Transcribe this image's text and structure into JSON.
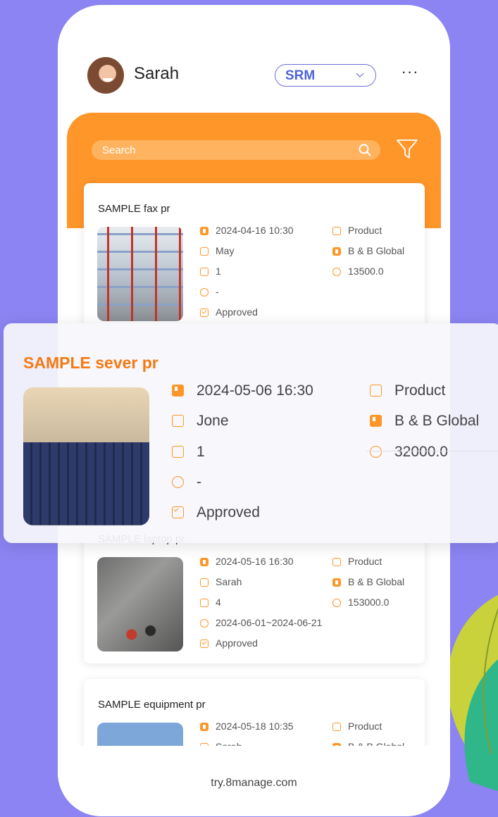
{
  "user": {
    "name": "Sarah"
  },
  "module": {
    "label": "SRM"
  },
  "menu": {
    "more": "···"
  },
  "search": {
    "placeholder": "Search"
  },
  "cards": [
    {
      "title": "SAMPLE fax pr",
      "datetime": "2024-04-16   10:30",
      "person": "May",
      "qty": "1",
      "period": "-",
      "status": "Approved",
      "category": "Product",
      "supplier": "B & B Global",
      "amount": "13500.0"
    },
    {
      "title": "SAMPLE laptop pr",
      "datetime": "2024-05-16   16:30",
      "person": "Sarah",
      "qty": "4",
      "period": "2024-06-01~2024-06-21",
      "status": "Approved",
      "category": "Product",
      "supplier": "B & B Global",
      "amount": "153000.0"
    },
    {
      "title": "SAMPLE equipment pr",
      "datetime": "2024-05-18   10:35",
      "person": "Sarah",
      "category": "Product",
      "supplier": "B & B Global"
    }
  ],
  "expanded": {
    "title": "SAMPLE sever pr",
    "datetime": "2024-05-06   16:30",
    "person": "Jone",
    "qty": "1",
    "period": "-",
    "status": "Approved",
    "category": "Product",
    "supplier": "B & B Global",
    "amount": "32000.0"
  },
  "footer": {
    "text": "try.8manage.com"
  },
  "colors": {
    "accent": "#ff9629",
    "background": "#8b84f2",
    "brand_blue": "#4e63d8",
    "title_orange": "#f47a13"
  }
}
